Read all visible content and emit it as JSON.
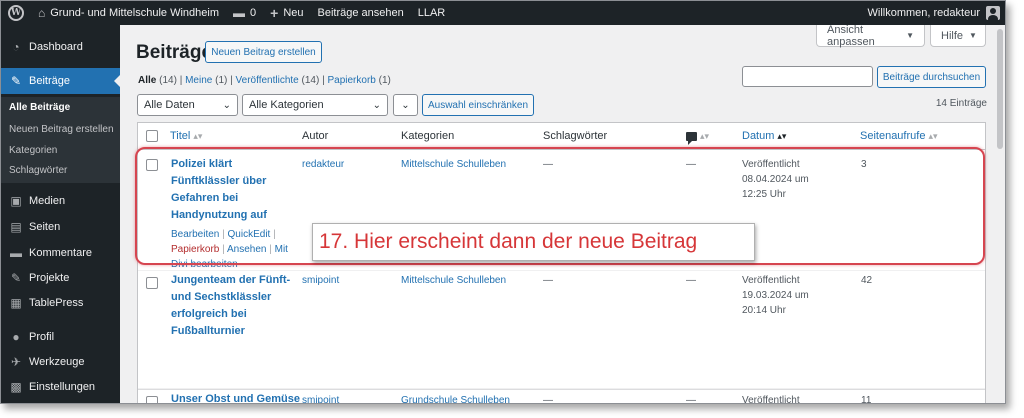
{
  "admin_bar": {
    "site_name": "Grund- und Mittelschule Windheim",
    "comments_count": "0",
    "new_label": "Neu",
    "view_posts_label": "Beiträge ansehen",
    "extra_label": "LLAR",
    "greeting": "Willkommen, redakteur"
  },
  "sidebar": {
    "items": [
      {
        "label": "Dashboard",
        "icon": "dashboard-icon"
      },
      {
        "label": "Beiträge",
        "icon": "pin-icon"
      },
      {
        "label": "Medien",
        "icon": "media-icon"
      },
      {
        "label": "Seiten",
        "icon": "page-icon"
      },
      {
        "label": "Kommentare",
        "icon": "comment-icon"
      },
      {
        "label": "Projekte",
        "icon": "pin-icon"
      },
      {
        "label": "TablePress",
        "icon": "table-icon"
      },
      {
        "label": "Profil",
        "icon": "user-icon"
      },
      {
        "label": "Werkzeuge",
        "icon": "wrench-icon"
      },
      {
        "label": "Einstellungen",
        "icon": "settings-icon"
      }
    ],
    "submenu": [
      "Alle Beiträge",
      "Neuen Beitrag erstellen",
      "Kategorien",
      "Schlagwörter"
    ]
  },
  "screen_meta": {
    "screen_options": "Ansicht anpassen",
    "help": "Hilfe"
  },
  "page": {
    "title": "Beiträge",
    "add_new": "Neuen Beitrag erstellen"
  },
  "views": {
    "all": "Alle",
    "all_count": "(14)",
    "mine": "Meine",
    "mine_count": "(1)",
    "published": "Veröffentlichte",
    "published_count": "(14)",
    "trash": "Papierkorb",
    "trash_count": "(1)"
  },
  "search": {
    "value": "",
    "button": "Beiträge durchsuchen"
  },
  "filters": {
    "dates": "Alle Daten",
    "categories": "Alle Kategorien",
    "filter_button": "Auswahl einschränken",
    "items_count": "14 Einträge"
  },
  "table": {
    "columns": {
      "title": "Titel",
      "author": "Autor",
      "categories": "Kategorien",
      "tags": "Schlagwörter",
      "date": "Datum",
      "views": "Seitenaufrufe"
    },
    "rows": [
      {
        "title_lines": [
          "Polizei klärt",
          "Fünftklässler über",
          "Gefahren bei",
          "Handynutzung auf"
        ],
        "author": "redakteur",
        "category": "Mittelschule Schulleben",
        "tags": "—",
        "comments": "—",
        "date_lines": [
          "Veröffentlicht",
          "08.04.2024 um",
          "12:25 Uhr"
        ],
        "views": "3",
        "actions": {
          "edit": "Bearbeiten",
          "quick_edit": "QuickEdit",
          "trash": "Papierkorb",
          "view": "Ansehen",
          "divi_1": "Mit",
          "divi_2": "Divi bearbeiten"
        }
      },
      {
        "title_lines": [
          "Jungenteam der Fünft-",
          "und Sechstklässler",
          "erfolgreich bei",
          "Fußballturnier"
        ],
        "author": "smipoint",
        "category": "Mittelschule Schulleben",
        "tags": "—",
        "comments": "—",
        "date_lines": [
          "Veröffentlicht",
          "19.03.2024 um",
          "20:14 Uhr"
        ],
        "views": "42"
      },
      {
        "title_lines": [
          "Unser Obst und Gemüse"
        ],
        "author": "smipoint",
        "category": "Grundschule Schulleben",
        "tags": "—",
        "comments": "—",
        "date_lines": [
          "Veröffentlicht"
        ],
        "views": "11"
      }
    ]
  },
  "annotation": {
    "text": "17. Hier erscheint dann der neue Beitrag",
    "color": "#d64550"
  }
}
